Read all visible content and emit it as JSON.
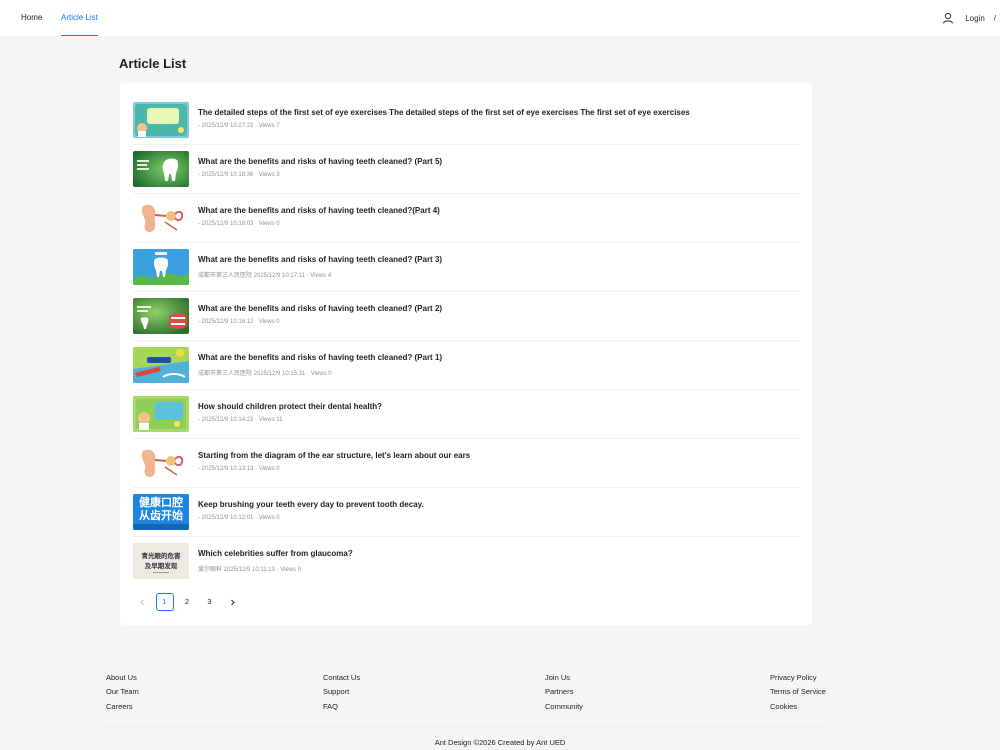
{
  "nav": {
    "home": "Home",
    "article_list": "Article List",
    "login": "Login",
    "separator": "/"
  },
  "page": {
    "title": "Article List"
  },
  "articles": [
    {
      "title": "The detailed steps of the first set of eye exercises The detailed steps of the first set of eye exercises The first set of eye exercises",
      "meta": "- 2025/12/9 10:27:23 · Views 7"
    },
    {
      "title": "What are the benefits and risks of having teeth cleaned? (Part 5)",
      "meta": "- 2025/12/9 10:18:36 · Views 3"
    },
    {
      "title": "What are the benefits and risks of having teeth cleaned?(Part 4)",
      "meta": "- 2025/12/9 10:18:03 · Views 0"
    },
    {
      "title": "What are the benefits and risks of having teeth cleaned? (Part 3)",
      "meta": "成都市第三人民医院 2025/12/9 10:17:11 · Views 4"
    },
    {
      "title": "What are the benefits and risks of having teeth cleaned? (Part 2)",
      "meta": "- 2025/12/9 10:16:12 · Views 0"
    },
    {
      "title": "What are the benefits and risks of having teeth cleaned? (Part 1)",
      "meta": "成都市第三人民医院 2025/12/9 10:15:31 · Views 0"
    },
    {
      "title": "How should children protect their dental health?",
      "meta": "- 2025/12/9 10:14:23 · Views 11"
    },
    {
      "title": "Starting from the diagram of the ear structure, let's learn about our ears",
      "meta": "- 2025/12/9 10:13:13 · Views 0"
    },
    {
      "title": "Keep brushing your teeth every day to prevent tooth decay.",
      "meta": "- 2025/12/9 10:12:01 · Views 0"
    },
    {
      "title": "Which celebrities suffer from glaucoma?",
      "meta": "爱尔眼科 2025/12/9 10:11:13 · Views 0"
    }
  ],
  "thumbnails": {
    "t9_line1": "健康口腔",
    "t9_line2": "从齿开始",
    "t10_line1": "青光眼的危害",
    "t10_line2": "及早期发现"
  },
  "pagination": {
    "pages": [
      "1",
      "2",
      "3"
    ],
    "current": "1",
    "prev_icon": "chevron-left-icon",
    "next_icon": "chevron-right-icon"
  },
  "footer": {
    "col1": [
      "About Us",
      "Our Team",
      "Careers"
    ],
    "col2": [
      "Contact Us",
      "Support",
      "FAQ"
    ],
    "col3": [
      "Join Us",
      "Partners",
      "Community"
    ],
    "col4": [
      "Privacy Policy",
      "Terms of Service",
      "Cookies"
    ],
    "copyright": "Ant Design ©2026 Created by Ant UED"
  },
  "colors": {
    "accent": "#1677ff",
    "background": "#f5f5f5",
    "card": "#ffffff"
  }
}
